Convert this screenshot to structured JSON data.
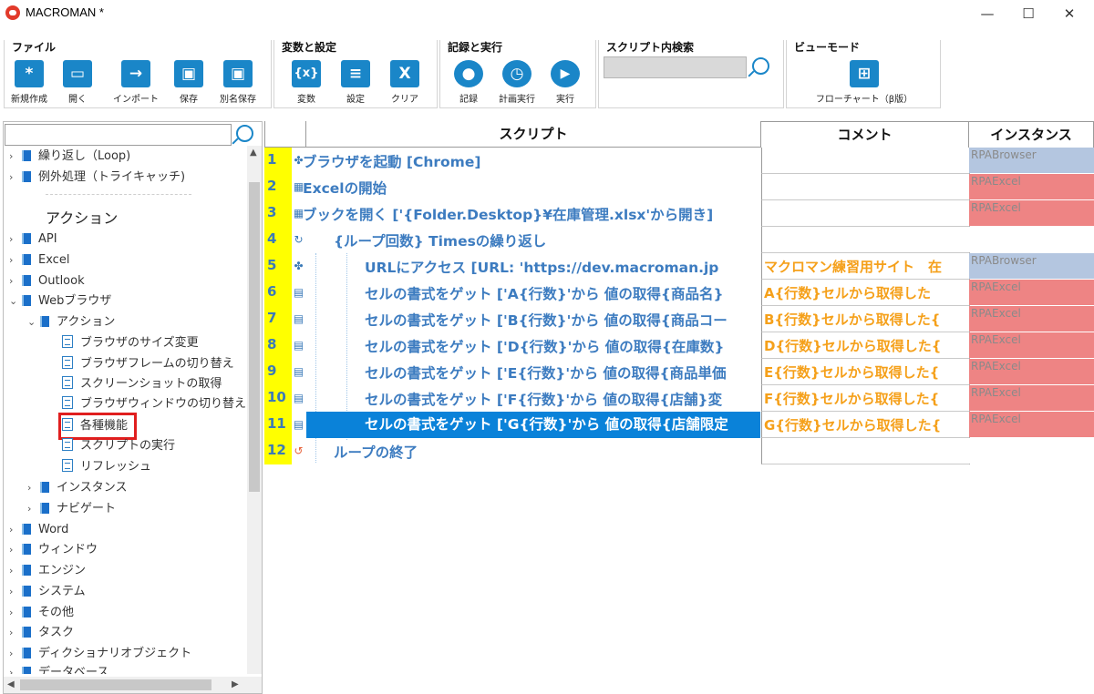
{
  "window": {
    "title": "MACROMAN *",
    "min": "—",
    "max": "☐",
    "close": "✕"
  },
  "ribbon": {
    "file": {
      "title": "ファイル",
      "buttons": [
        {
          "label": "新規作成",
          "icon": "*"
        },
        {
          "label": "開く",
          "icon": "▭"
        },
        {
          "label": "インポート",
          "icon": "→"
        },
        {
          "label": "保存",
          "icon": "▣"
        },
        {
          "label": "別名保存",
          "icon": "▣"
        }
      ]
    },
    "vars": {
      "title": "変数と設定",
      "buttons": [
        {
          "label": "変数",
          "icon": "{x}"
        },
        {
          "label": "設定",
          "icon": "≡"
        },
        {
          "label": "クリア",
          "icon": "X"
        }
      ]
    },
    "rec": {
      "title": "記録と実行",
      "buttons": [
        {
          "label": "記録",
          "icon": "●"
        },
        {
          "label": "計画実行",
          "icon": "◷"
        },
        {
          "label": "実行",
          "icon": "▶"
        }
      ]
    },
    "search": {
      "title": "スクリプト内検索"
    },
    "view": {
      "title": "ビューモード",
      "button": {
        "label": "フローチャート（β版）",
        "icon": "⊞"
      }
    }
  },
  "tree": {
    "top": [
      {
        "label": "繰り返し（Loop)"
      },
      {
        "label": "例外処理（トライキャッチ)"
      }
    ],
    "heading": "アクション",
    "items": [
      {
        "label": "API",
        "chev": "›"
      },
      {
        "label": "Excel",
        "chev": "›"
      },
      {
        "label": "Outlook",
        "chev": "›"
      },
      {
        "label": "Webブラウザ",
        "chev": "⌄"
      }
    ],
    "sub": {
      "label": "アクション",
      "chev": "⌄"
    },
    "leaves": [
      {
        "label": "ブラウザのサイズ変更"
      },
      {
        "label": "ブラウザフレームの切り替え"
      },
      {
        "label": "スクリーンショットの取得"
      },
      {
        "label": "ブラウザウィンドウの切り替え"
      },
      {
        "label": "各種機能"
      },
      {
        "label": "スクリプトの実行"
      },
      {
        "label": "リフレッシュ"
      }
    ],
    "sub2": [
      {
        "label": "インスタンス",
        "chev": "›"
      },
      {
        "label": "ナビゲート",
        "chev": "›"
      }
    ],
    "bottom": [
      {
        "label": "Word"
      },
      {
        "label": "ウィンドウ"
      },
      {
        "label": "エンジン"
      },
      {
        "label": "システム"
      },
      {
        "label": "その他"
      },
      {
        "label": "タスク"
      },
      {
        "label": "ディクショナリオブジェクト"
      },
      {
        "label": "データベース"
      }
    ]
  },
  "grid": {
    "headers": {
      "script": "スクリプト",
      "comment": "コメント",
      "instance": "インスタンス"
    },
    "rows": [
      {
        "num": "1",
        "text": "ブラウザを起動 [Chrome]",
        "comment": "",
        "instance": "RPABrowser",
        "icolor": "#b4c6e0"
      },
      {
        "num": "2",
        "text": "Excelの開始",
        "comment": "",
        "instance": "RPAExcel",
        "icolor": "#ee8484"
      },
      {
        "num": "3",
        "text": "ブックを開く ['{Folder.Desktop}¥在庫管理.xlsx'から開き]",
        "comment": "",
        "instance": "RPAExcel",
        "icolor": "#ee8484"
      },
      {
        "num": "4",
        "text": "{ループ回数} Timesの繰り返し",
        "comment": "",
        "instance": "",
        "icolor": "#ffffff"
      },
      {
        "num": "5",
        "text": "URLにアクセス [URL: 'https://dev.macroman.jp",
        "comment": "マクロマン練習用サイト　在",
        "instance": "RPABrowser",
        "icolor": "#b4c6e0"
      },
      {
        "num": "6",
        "text": "セルの書式をゲット ['A{行数}'から 値の取得{商品名}",
        "comment": "A{行数}セルから取得した",
        "instance": "RPAExcel",
        "icolor": "#ee8484"
      },
      {
        "num": "7",
        "text": "セルの書式をゲット ['B{行数}'から 値の取得{商品コー",
        "comment": "B{行数}セルから取得した{",
        "instance": "RPAExcel",
        "icolor": "#ee8484"
      },
      {
        "num": "8",
        "text": "セルの書式をゲット ['D{行数}'から 値の取得{在庫数}",
        "comment": "D{行数}セルから取得した{",
        "instance": "RPAExcel",
        "icolor": "#ee8484"
      },
      {
        "num": "9",
        "text": "セルの書式をゲット ['E{行数}'から 値の取得{商品単価",
        "comment": "E{行数}セルから取得した{",
        "instance": "RPAExcel",
        "icolor": "#ee8484"
      },
      {
        "num": "10",
        "text": "セルの書式をゲット ['F{行数}'から 値の取得{店舗}変",
        "comment": "F{行数}セルから取得した{",
        "instance": "RPAExcel",
        "icolor": "#ee8484"
      },
      {
        "num": "11",
        "text": "セルの書式をゲット ['G{行数}'から 値の取得{店舗限定",
        "comment": "G{行数}セルから取得した{",
        "instance": "RPAExcel",
        "icolor": "#ee8484"
      },
      {
        "num": "12",
        "text": "ループの終了",
        "comment": "",
        "instance": "",
        "icolor": "#ffffff"
      }
    ]
  }
}
